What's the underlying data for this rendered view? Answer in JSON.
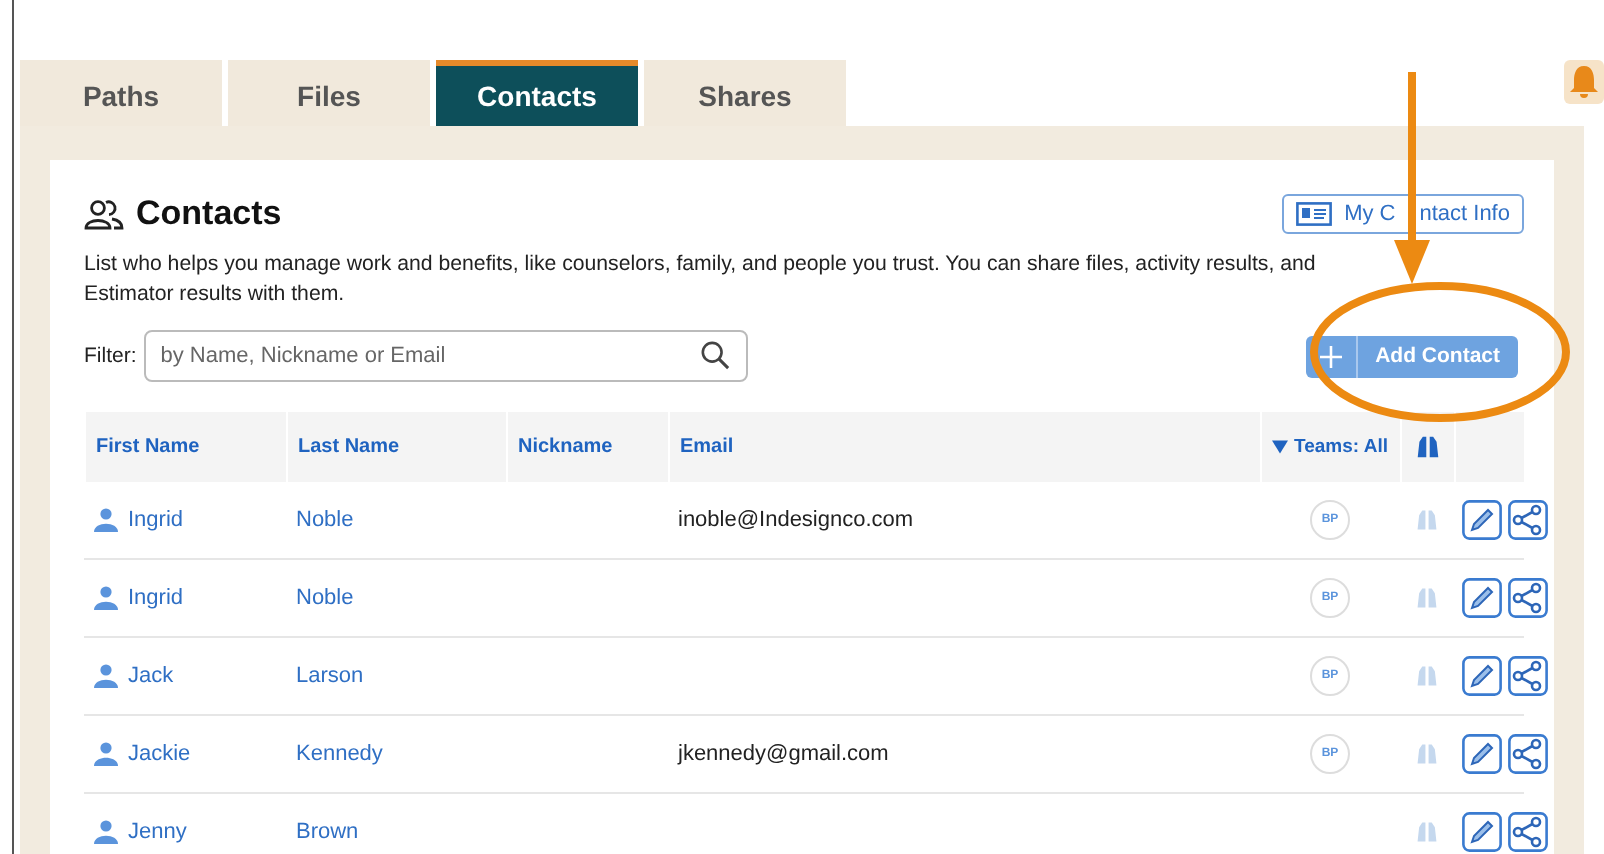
{
  "tabs": [
    {
      "label": "Paths",
      "selected": false
    },
    {
      "label": "Files",
      "selected": false
    },
    {
      "label": "Contacts",
      "selected": true
    },
    {
      "label": "Shares",
      "selected": false
    }
  ],
  "contacts": {
    "title": "Contacts",
    "my_contact_info": [
      "My C",
      "ntact Info"
    ],
    "description": "List who helps you manage work and benefits, like counselors, family, and people you trust. You can share files, activity results, and Estimator results with them.",
    "filter": {
      "label": "Filter:",
      "placeholder": "by Name, Nickname or Email"
    },
    "add_button": "Add Contact",
    "columns": [
      "First Name",
      "Last Name",
      "Nickname",
      "Email"
    ],
    "teams_filter": "Teams: All",
    "rows": [
      {
        "first_name": "Ingrid",
        "last_name": "Noble",
        "email": "inoble@Indesignco.com",
        "team": "BP"
      },
      {
        "first_name": "Ingrid",
        "last_name": "Noble",
        "team": "BP"
      },
      {
        "first_name": "Jack",
        "last_name": "Larson",
        "team": "BP"
      },
      {
        "first_name": "Jackie",
        "last_name": "Kennedy",
        "email": "jkennedy@gmail.com",
        "team": "BP"
      },
      {
        "first_name": "Jenny",
        "last_name": "Brown"
      }
    ]
  }
}
